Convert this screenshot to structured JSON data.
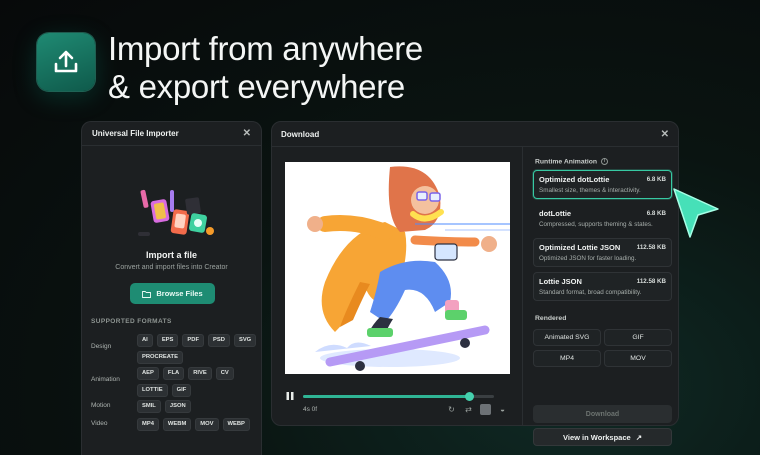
{
  "hero": {
    "line1": "Import from anywhere",
    "line2": "& export everywhere",
    "icon": "upload-icon"
  },
  "importer": {
    "title": "Universal File Importer",
    "close": "✕",
    "import_title": "Import a file",
    "import_subtitle": "Convert and import files into Creator",
    "browse_label": "Browse Files",
    "supported_heading": "SUPPORTED FORMATS",
    "groups": [
      {
        "label": "Design",
        "formats": [
          "AI",
          "EPS",
          "PDF",
          "PSD",
          "SVG",
          "PROCREATE"
        ]
      },
      {
        "label": "Animation",
        "formats": [
          "AEP",
          "FLA",
          "RIVE",
          "CV",
          "LOTTIE",
          "GIF"
        ]
      },
      {
        "label": "Motion",
        "formats": [
          "SMIL",
          "JSON"
        ]
      },
      {
        "label": "Video",
        "formats": [
          "MP4",
          "WEBM",
          "MOV",
          "WEBP"
        ]
      }
    ]
  },
  "download": {
    "title": "Download",
    "close": "✕",
    "time": "4s 0f",
    "progress": 0.87,
    "runtime_heading": "Runtime Animation",
    "options": [
      {
        "name": "Optimized dotLottie",
        "size": "6.8 KB",
        "desc": "Smallest size, themes & interactivity.",
        "selected": true
      },
      {
        "name": "dotLottie",
        "size": "6.8 KB",
        "desc": "Compressed, supports theming & states.",
        "selected": false
      },
      {
        "name": "Optimized Lottie JSON",
        "size": "112.58 KB",
        "desc": "Optimized JSON for faster loading.",
        "selected": false
      },
      {
        "name": "Lottie JSON",
        "size": "112.58 KB",
        "desc": "Standard format, broad compatibility.",
        "selected": false
      }
    ],
    "rendered_heading": "Rendered",
    "rendered": [
      "Animated SVG",
      "GIF",
      "MP4",
      "MOV"
    ],
    "download_label": "Download",
    "workspace_label": "View in Workspace",
    "workspace_icon": "↗"
  },
  "colors": {
    "accent": "#1e8c73",
    "selected_border": "#37c9a3",
    "cursor": "#46e0b8"
  }
}
